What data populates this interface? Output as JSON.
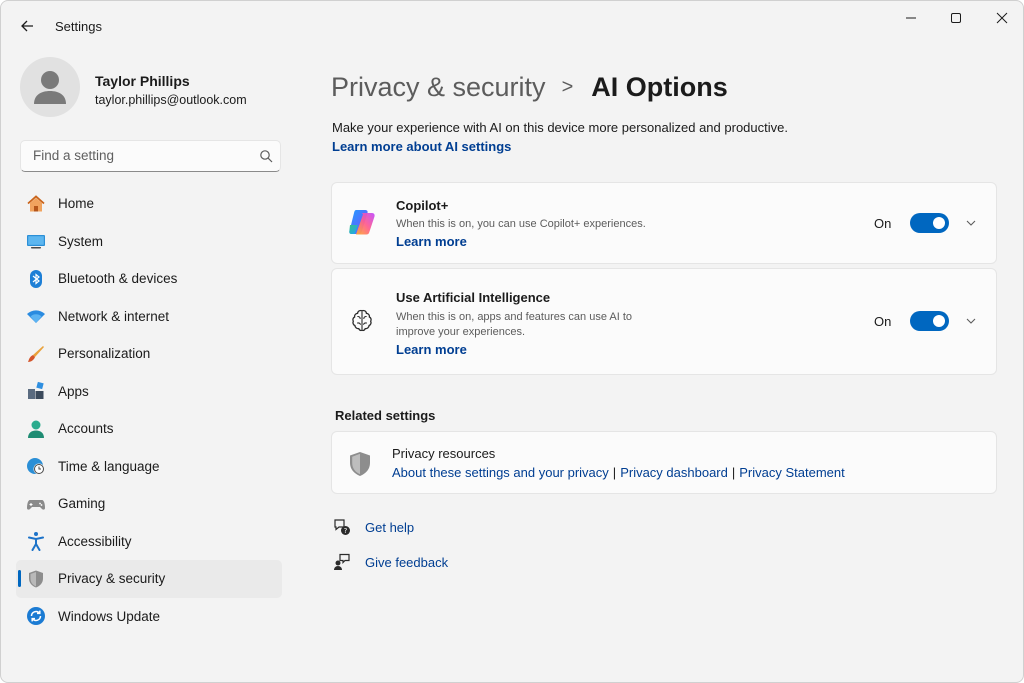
{
  "window": {
    "app_title": "Settings",
    "icons": {
      "back": "back-arrow-icon",
      "minimize": "minimize-icon",
      "maximize": "maximize-icon",
      "close": "close-icon"
    }
  },
  "profile": {
    "name": "Taylor Phillips",
    "email": "taylor.phillips@outlook.com"
  },
  "search": {
    "placeholder": "Find a setting",
    "value": ""
  },
  "sidebar": {
    "items": [
      {
        "label": "Home",
        "icon": "home-icon",
        "active": false
      },
      {
        "label": "System",
        "icon": "system-icon",
        "active": false
      },
      {
        "label": "Bluetooth & devices",
        "icon": "bluetooth-icon",
        "active": false
      },
      {
        "label": "Network & internet",
        "icon": "wifi-icon",
        "active": false
      },
      {
        "label": "Personalization",
        "icon": "brush-icon",
        "active": false
      },
      {
        "label": "Apps",
        "icon": "apps-icon",
        "active": false
      },
      {
        "label": "Accounts",
        "icon": "accounts-icon",
        "active": false
      },
      {
        "label": "Time & language",
        "icon": "globe-clock-icon",
        "active": false
      },
      {
        "label": "Gaming",
        "icon": "gamepad-icon",
        "active": false
      },
      {
        "label": "Accessibility",
        "icon": "accessibility-icon",
        "active": false
      },
      {
        "label": "Privacy & security",
        "icon": "shield-icon",
        "active": true
      },
      {
        "label": "Windows Update",
        "icon": "update-icon",
        "active": false
      }
    ]
  },
  "main": {
    "breadcrumb": {
      "parent": "Privacy & security",
      "separator": ">",
      "current": "AI Options"
    },
    "description": "Make your experience with AI on this device more personalized and productive.",
    "learn_more_ai": "Learn more about AI settings",
    "cards": [
      {
        "title": "Copilot+",
        "description": "When this is on, you can use Copilot+ experiences.",
        "link": "Learn more",
        "toggle_state": "On",
        "toggle_on": true,
        "icon": "copilot-icon"
      },
      {
        "title": "Use Artificial Intelligence",
        "description": "When this is on, apps and features can use AI to improve your experiences.",
        "link": "Learn more",
        "toggle_state": "On",
        "toggle_on": true,
        "icon": "brain-icon"
      }
    ],
    "related": {
      "heading": "Related settings",
      "title": "Privacy resources",
      "links": [
        "About these settings and your privacy",
        "Privacy dashboard",
        "Privacy Statement"
      ],
      "separator": "|",
      "icon": "shield-icon"
    },
    "help": {
      "get_help": "Get help",
      "give_feedback": "Give feedback"
    }
  },
  "colors": {
    "accent": "#0067c0",
    "link": "#003e92",
    "background": "#f3f3f3",
    "card": "#fbfbfb"
  }
}
